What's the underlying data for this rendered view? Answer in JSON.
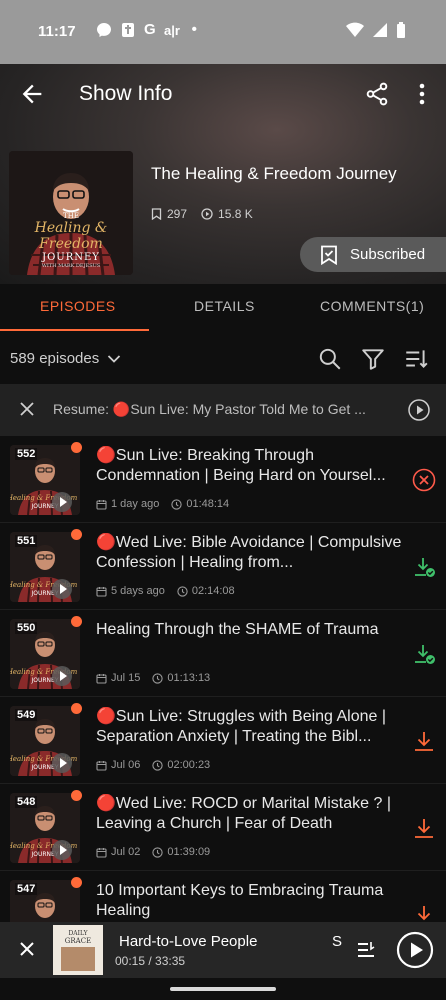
{
  "status_bar": {
    "time": "11:17",
    "left_icons": [
      "messenger-icon",
      "bible-icon",
      "google-icon",
      "translate-icon",
      "dot-icon"
    ],
    "g_label": "G",
    "dot": "•"
  },
  "header": {
    "title": "Show Info"
  },
  "show": {
    "title": "The Healing & Freedom Journey",
    "bookmarks": "297",
    "plays": "15.8 K",
    "cover": {
      "line1": "THE",
      "line2": "Healing & Freedom",
      "line3": "JOURNEY",
      "line4": "WITH MARK DEJESUS"
    },
    "subscribe_label": "Subscribed"
  },
  "tabs": [
    {
      "label": "EPISODES",
      "active": true
    },
    {
      "label": "DETAILS",
      "active": false
    },
    {
      "label": "COMMENTS(1)",
      "active": false
    }
  ],
  "episodes_bar": {
    "count_label": "589 episodes"
  },
  "resume": {
    "text": "Resume: 🔴Sun Live: My Pastor Told Me to Get ..."
  },
  "episodes": [
    {
      "number": "552",
      "title": "🔴Sun Live: Breaking Through Condemnation | Being Hard on Yoursel...",
      "date": "1 day ago",
      "duration": "01:48:14",
      "action": "cancel-download",
      "unplayed": true
    },
    {
      "number": "551",
      "title": "🔴Wed Live: Bible Avoidance | Compulsive Confession | Healing from...",
      "date": "5 days ago",
      "duration": "02:14:08",
      "action": "downloaded",
      "unplayed": true
    },
    {
      "number": "550",
      "title": "Healing Through the SHAME of Trauma",
      "date": "Jul 15",
      "duration": "01:13:13",
      "action": "downloaded",
      "unplayed": true
    },
    {
      "number": "549",
      "title": "🔴Sun Live: Struggles with Being Alone | Separation Anxiety | Treating the Bibl...",
      "date": "Jul 06",
      "duration": "02:00:23",
      "action": "download",
      "unplayed": true
    },
    {
      "number": "548",
      "title": "🔴Wed Live: ROCD or Marital Mistake ? | Leaving a Church | Fear of Death",
      "date": "Jul 02",
      "duration": "01:39:09",
      "action": "download",
      "unplayed": true
    },
    {
      "number": "547",
      "title": "10 Important Keys to Embracing Trauma Healing",
      "date": "",
      "duration": "",
      "action": "download",
      "unplayed": true
    }
  ],
  "player": {
    "title": "Hard-to-Love People",
    "time": "00:15 / 33:35",
    "next_peek": "S",
    "art_line1": "DAILY",
    "art_line2": "GRACE"
  },
  "colors": {
    "accent": "#ff6a39",
    "downloaded": "#3fbf6a",
    "cancel": "#ff5a4a",
    "background": "#0f0f0f"
  }
}
